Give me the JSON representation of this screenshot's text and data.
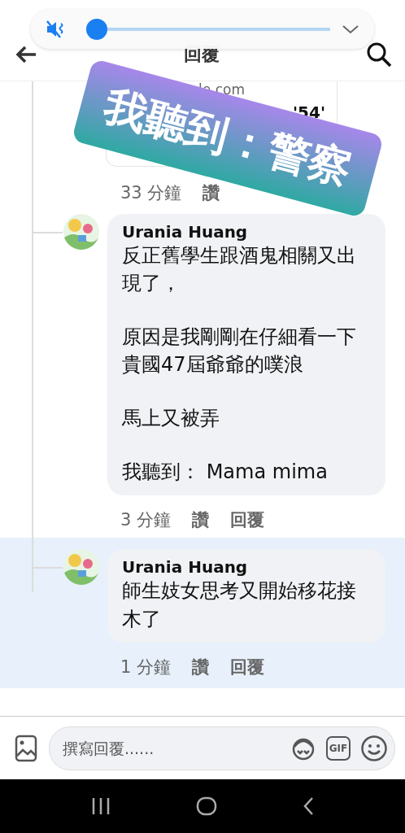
{
  "volume_panel": {
    "muted": true,
    "level": 0.0
  },
  "header": {
    "title": "回覆"
  },
  "link_preview": {
    "domain": "le.com",
    "title": "'54'"
  },
  "link_meta": {
    "time": "33 分鐘",
    "like": "讚"
  },
  "comments": [
    {
      "author": "Urania Huang",
      "paragraphs": [
        "反正舊學生跟酒鬼相關又出現了，",
        "原因是我剛剛在仔細看一下貴國47屆爺爺的噗浪",
        "馬上又被弄",
        "我聽到： Mama mima"
      ],
      "time": "3 分鐘",
      "like": "讚",
      "reply": "回覆",
      "highlighted": false
    },
    {
      "author": "Urania Huang",
      "paragraphs": [
        "師生妓女思考又開始移花接木了"
      ],
      "time": "1 分鐘",
      "like": "讚",
      "reply": "回覆",
      "highlighted": true
    }
  ],
  "composer": {
    "placeholder": "撰寫回覆......",
    "gif": "GIF"
  },
  "sticker": {
    "text": "我聽到：警察"
  }
}
